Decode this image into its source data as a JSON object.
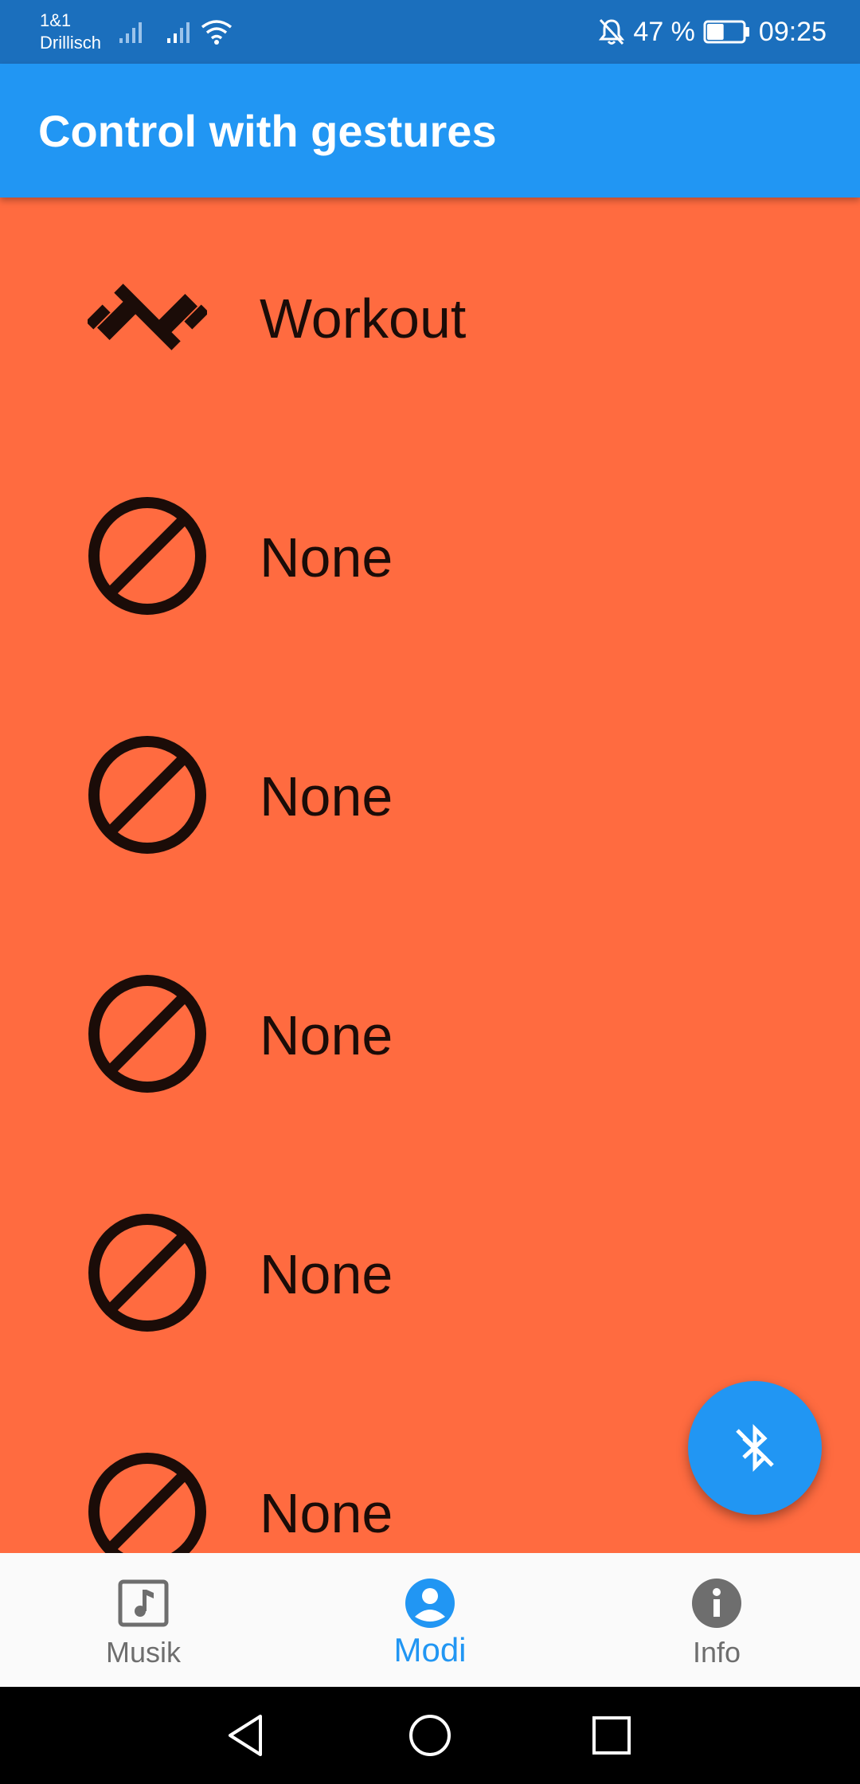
{
  "status_bar": {
    "carrier_line1": "1&1",
    "carrier_line2": "Drillisch",
    "battery_percent": "47 %",
    "time": "09:25",
    "battery_level": 0.47,
    "icons": [
      "signal-icon",
      "signal-icon",
      "wifi-icon",
      "bell-off-icon",
      "battery-icon"
    ]
  },
  "app_bar": {
    "title": "Control with gestures"
  },
  "modes": [
    {
      "label": "Workout",
      "icon": "dumbbell-icon"
    },
    {
      "label": "None",
      "icon": "block-icon"
    },
    {
      "label": "None",
      "icon": "block-icon"
    },
    {
      "label": "None",
      "icon": "block-icon"
    },
    {
      "label": "None",
      "icon": "block-icon"
    },
    {
      "label": "None",
      "icon": "block-icon"
    }
  ],
  "fab": {
    "icon": "bluetooth-disabled-icon"
  },
  "bottom_nav": {
    "items": [
      {
        "label": "Musik",
        "icon": "music-note-icon",
        "active": false
      },
      {
        "label": "Modi",
        "icon": "account-circle-icon",
        "active": true
      },
      {
        "label": "Info",
        "icon": "info-icon",
        "active": false
      }
    ]
  },
  "system_nav": {
    "buttons": [
      "back-icon",
      "home-icon",
      "recents-icon"
    ]
  },
  "colors": {
    "status_bar": "#1b6fbd",
    "app_bar": "#2196f3",
    "background": "#ff6b40",
    "accent": "#2196f3",
    "icon_dark": "#1b0c08",
    "nav_inactive": "#6e6e6e"
  }
}
